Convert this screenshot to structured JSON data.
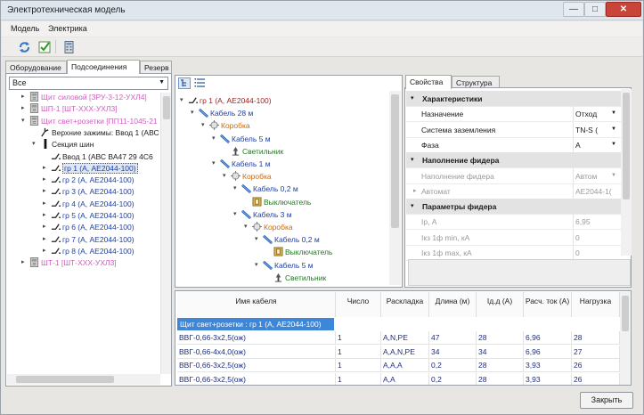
{
  "window": {
    "title": "Электротехническая модель",
    "min": "—",
    "max": "□",
    "close": "✕"
  },
  "menu": {
    "items": [
      "Модель",
      "Электрика"
    ]
  },
  "colors": {
    "pink": "#d35bc0",
    "blue": "#1f3fa0",
    "orange": "#c86a12",
    "green": "#1d7c1d",
    "selection": "#3d86d8",
    "dark_red": "#9b1f1f"
  },
  "toolbar": {
    "icons": [
      "refresh-icon",
      "checkbox-icon",
      "calculator-icon"
    ]
  },
  "left": {
    "tabs": [
      "Оборудование",
      "Подсоединения",
      "Резерв"
    ],
    "filter_value": "Все",
    "tree": [
      {
        "level": 1,
        "expander": "▸",
        "icon": "shield",
        "label": "Щит силовой [ЗРУ-3-12-УХЛ4]",
        "color": "pink"
      },
      {
        "level": 1,
        "expander": "▸",
        "icon": "shield",
        "label": "ШП-1 [ШТ-ХХХ-УХЛ3]",
        "color": "pink"
      },
      {
        "level": 1,
        "expander": "▾",
        "icon": "shield",
        "label": "Щит свет+розетки [ПП11-1045-21",
        "color": "pink"
      },
      {
        "level": 2,
        "expander": "",
        "icon": "switch",
        "label": "Верхние зажимы: Ввод 1 (АВС",
        "color": "dark"
      },
      {
        "level": 2,
        "expander": "▾",
        "icon": "bus",
        "label": "Секция шин",
        "color": "dark"
      },
      {
        "level": 3,
        "expander": "",
        "icon": "breaker",
        "label": "Ввод 1 (АВС ВА47 29 4С6",
        "color": "dark"
      },
      {
        "level": 3,
        "expander": "▸",
        "icon": "breaker",
        "label": "гр 1 (А, АЕ2044-100)",
        "color": "blue",
        "selected": true
      },
      {
        "level": 3,
        "expander": "▸",
        "icon": "breaker",
        "label": "гр 2 (А, АЕ2044-100)",
        "color": "blue"
      },
      {
        "level": 3,
        "expander": "▸",
        "icon": "breaker",
        "label": "гр 3 (А, АЕ2044-100)",
        "color": "blue"
      },
      {
        "level": 3,
        "expander": "▸",
        "icon": "breaker",
        "label": "гр 4 (А, АЕ2044-100)",
        "color": "blue"
      },
      {
        "level": 3,
        "expander": "▸",
        "icon": "breaker",
        "label": "гр 5 (А, АЕ2044-100)",
        "color": "blue"
      },
      {
        "level": 3,
        "expander": "▸",
        "icon": "breaker",
        "label": "гр 6 (А, АЕ2044-100)",
        "color": "blue"
      },
      {
        "level": 3,
        "expander": "▸",
        "icon": "breaker",
        "label": "гр 7 (А, АЕ2044-100)",
        "color": "blue"
      },
      {
        "level": 3,
        "expander": "▸",
        "icon": "breaker",
        "label": "гр 8 (А, АЕ2044-100)",
        "color": "blue"
      },
      {
        "level": 1,
        "expander": "▸",
        "icon": "shield",
        "label": "ШТ-1 [ШТ-ХХХ-УХЛ3]",
        "color": "pink"
      }
    ]
  },
  "middle": {
    "tree": [
      {
        "level": 0,
        "expander": "▾",
        "icon": "breaker",
        "label": "гр 1 (А, АЕ2044-100)",
        "color": "dark_red"
      },
      {
        "level": 1,
        "expander": "▾",
        "icon": "cable",
        "label": "Кабель 28 м",
        "color": "blue"
      },
      {
        "level": 2,
        "expander": "▾",
        "icon": "box",
        "label": "Коробка",
        "color": "orange"
      },
      {
        "level": 3,
        "expander": "▾",
        "icon": "cable",
        "label": "Кабель 5 м",
        "color": "blue"
      },
      {
        "level": 4,
        "expander": "",
        "icon": "lamp",
        "label": "Светильник",
        "color": "green"
      },
      {
        "level": 3,
        "expander": "▾",
        "icon": "cable",
        "label": "Кабель 1 м",
        "color": "blue"
      },
      {
        "level": 4,
        "expander": "▾",
        "icon": "box",
        "label": "Коробка",
        "color": "orange"
      },
      {
        "level": 5,
        "expander": "▾",
        "icon": "cable",
        "label": "Кабель 0,2 м",
        "color": "blue"
      },
      {
        "level": 6,
        "expander": "",
        "icon": "switchbox",
        "label": "Выключатель",
        "color": "green"
      },
      {
        "level": 5,
        "expander": "▾",
        "icon": "cable",
        "label": "Кабель 3 м",
        "color": "blue"
      },
      {
        "level": 6,
        "expander": "▾",
        "icon": "box",
        "label": "Коробка",
        "color": "orange"
      },
      {
        "level": 7,
        "expander": "▾",
        "icon": "cable",
        "label": "Кабель 0,2 м",
        "color": "blue"
      },
      {
        "level": 8,
        "expander": "",
        "icon": "switchbox",
        "label": "Выключатель",
        "color": "green"
      },
      {
        "level": 7,
        "expander": "▾",
        "icon": "cable",
        "label": "Кабель 5 м",
        "color": "blue"
      },
      {
        "level": 8,
        "expander": "",
        "icon": "lamp",
        "label": "Светильник",
        "color": "green"
      }
    ]
  },
  "right": {
    "tabs": [
      "Свойства",
      "Структура"
    ],
    "rows": [
      {
        "type": "cat",
        "name": "Характеристики"
      },
      {
        "type": "prop",
        "name": "Назначение",
        "value": "Отход",
        "dropdown": true
      },
      {
        "type": "prop",
        "name": "Система заземления",
        "value": "TN-S (",
        "dropdown": true
      },
      {
        "type": "prop",
        "name": "Фаза",
        "value": "А",
        "dropdown": true
      },
      {
        "type": "cat",
        "name": "Наполнение фидера"
      },
      {
        "type": "prop",
        "name": "Наполнение фидера",
        "value": "Автом",
        "dropdown": true,
        "disabled": true
      },
      {
        "type": "prop",
        "name": "Автомат",
        "value": "АЕ2044-1(",
        "expander": "▸",
        "disabled": true
      },
      {
        "type": "cat",
        "name": "Параметры фидера"
      },
      {
        "type": "prop",
        "name": "Ip, А",
        "value": "6,95",
        "disabled": true
      },
      {
        "type": "prop",
        "name": "Iкз 1ф min, кА",
        "value": "0",
        "disabled": true
      },
      {
        "type": "prop",
        "name": "Iкз 1ф max, кА",
        "value": "0",
        "disabled": true
      }
    ]
  },
  "grid": {
    "columns": [
      "Имя кабеля",
      "Число",
      "Раскладка",
      "Длина (м)",
      "Iд.д (А)",
      "Расч. ток (А)",
      "Нагрузка"
    ],
    "group_label": "Щит свет+розетки : гр 1 (А, АЕ2044-100)",
    "rows": [
      [
        "ВВГ-0,66-3х2,5(ож)",
        "1",
        "A,N,PE",
        "47",
        "28",
        "6,96",
        "28"
      ],
      [
        "ВВГ-0,66-4х4,0(ож)",
        "1",
        "A,A,N,PE",
        "34",
        "34",
        "6,96",
        "27"
      ],
      [
        "ВВГ-0,66-3х2,5(ож)",
        "1",
        "A,A,A",
        "0,2",
        "28",
        "3,93",
        "26"
      ],
      [
        "ВВГ-0,66-3х2,5(ож)",
        "1",
        "A,A",
        "0,2",
        "28",
        "3,93",
        "26"
      ]
    ]
  },
  "footer": {
    "close_label": "Закрыть"
  }
}
